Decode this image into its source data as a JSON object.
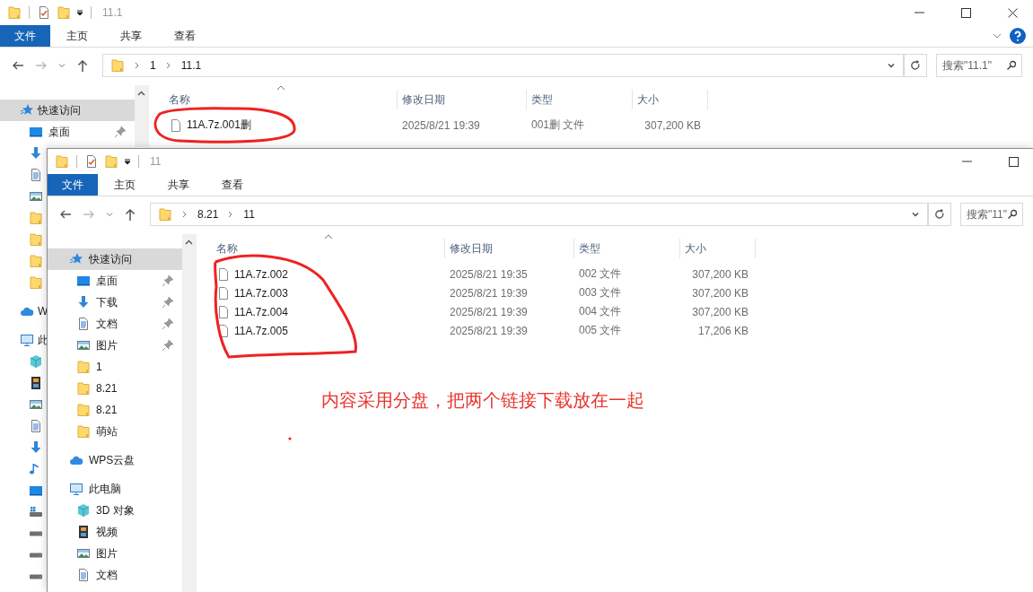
{
  "windows": [
    {
      "title": "11.1",
      "close_button": true,
      "help_button": true,
      "ribbon_tabs": [
        {
          "label": "文件",
          "selected": true
        },
        {
          "label": "主页",
          "selected": false
        },
        {
          "label": "共享",
          "selected": false
        },
        {
          "label": "查看",
          "selected": false
        }
      ],
      "breadcrumb": [
        "1",
        "11.1"
      ],
      "search": {
        "placeholder": "搜索\"11.1\""
      },
      "sidebar": [
        {
          "kind": "star",
          "label": "快速访问",
          "selected": true,
          "children": [
            {
              "kind": "desktop",
              "label": "桌面",
              "pinned": true
            },
            {
              "kind": "download"
            },
            {
              "kind": "document"
            },
            {
              "kind": "picture"
            },
            {
              "kind": "folder"
            },
            {
              "kind": "folder"
            },
            {
              "kind": "folder"
            },
            {
              "kind": "folder"
            }
          ]
        },
        {
          "kind": "cloud",
          "label": "W",
          "selected": false
        },
        {
          "kind": "computer",
          "label": "此",
          "selected": false,
          "children": [
            {
              "kind": "cube"
            },
            {
              "kind": "film"
            },
            {
              "kind": "picture"
            },
            {
              "kind": "document"
            },
            {
              "kind": "download"
            },
            {
              "kind": "music"
            },
            {
              "kind": "desktop"
            },
            {
              "kind": "drive-win"
            },
            {
              "kind": "drive"
            },
            {
              "kind": "drive"
            },
            {
              "kind": "drive"
            }
          ]
        }
      ],
      "columns": [
        "名称",
        "修改日期",
        "类型",
        "大小"
      ],
      "files": [
        {
          "name": "11A.7z.001删",
          "modified": "2025/8/21 19:39",
          "type": "001删 文件",
          "size": "307,200 KB"
        }
      ]
    },
    {
      "title": "11",
      "close_button": false,
      "help_button": false,
      "ribbon_tabs": [
        {
          "label": "文件",
          "selected": true
        },
        {
          "label": "主页",
          "selected": false
        },
        {
          "label": "共享",
          "selected": false
        },
        {
          "label": "查看",
          "selected": false
        }
      ],
      "breadcrumb": [
        "8.21",
        "11"
      ],
      "search": {
        "placeholder": "搜索\"11\""
      },
      "sidebar": [
        {
          "kind": "star",
          "label": "快速访问",
          "selected": true,
          "children": [
            {
              "kind": "desktop",
              "label": "桌面",
              "pinned": true
            },
            {
              "kind": "download",
              "label": "下载",
              "pinned": true
            },
            {
              "kind": "document",
              "label": "文档",
              "pinned": true
            },
            {
              "kind": "picture",
              "label": "图片",
              "pinned": true
            },
            {
              "kind": "folder",
              "label": "1",
              "pinned": false
            },
            {
              "kind": "folder",
              "label": "8.21",
              "pinned": false
            },
            {
              "kind": "folder",
              "label": "8.21",
              "pinned": false
            },
            {
              "kind": "folder",
              "label": "萌站",
              "pinned": false
            }
          ]
        },
        {
          "kind": "cloud",
          "label": "WPS云盘",
          "selected": false
        },
        {
          "kind": "computer",
          "label": "此电脑",
          "selected": false,
          "children": [
            {
              "kind": "cube",
              "label": "3D 对象"
            },
            {
              "kind": "film",
              "label": "视频"
            },
            {
              "kind": "picture",
              "label": "图片"
            },
            {
              "kind": "document",
              "label": "文档"
            }
          ]
        }
      ],
      "columns": [
        "名称",
        "修改日期",
        "类型",
        "大小"
      ],
      "files": [
        {
          "name": "11A.7z.002",
          "modified": "2025/8/21 19:35",
          "type": "002 文件",
          "size": "307,200 KB"
        },
        {
          "name": "11A.7z.003",
          "modified": "2025/8/21 19:39",
          "type": "003 文件",
          "size": "307,200 KB"
        },
        {
          "name": "11A.7z.004",
          "modified": "2025/8/21 19:39",
          "type": "004 文件",
          "size": "307,200 KB"
        },
        {
          "name": "11A.7z.005",
          "modified": "2025/8/21 19:39",
          "type": "005 文件",
          "size": "17,206 KB"
        }
      ]
    }
  ],
  "annotation": {
    "note": "内容采用分盘，把两个链接下载放在一起"
  }
}
